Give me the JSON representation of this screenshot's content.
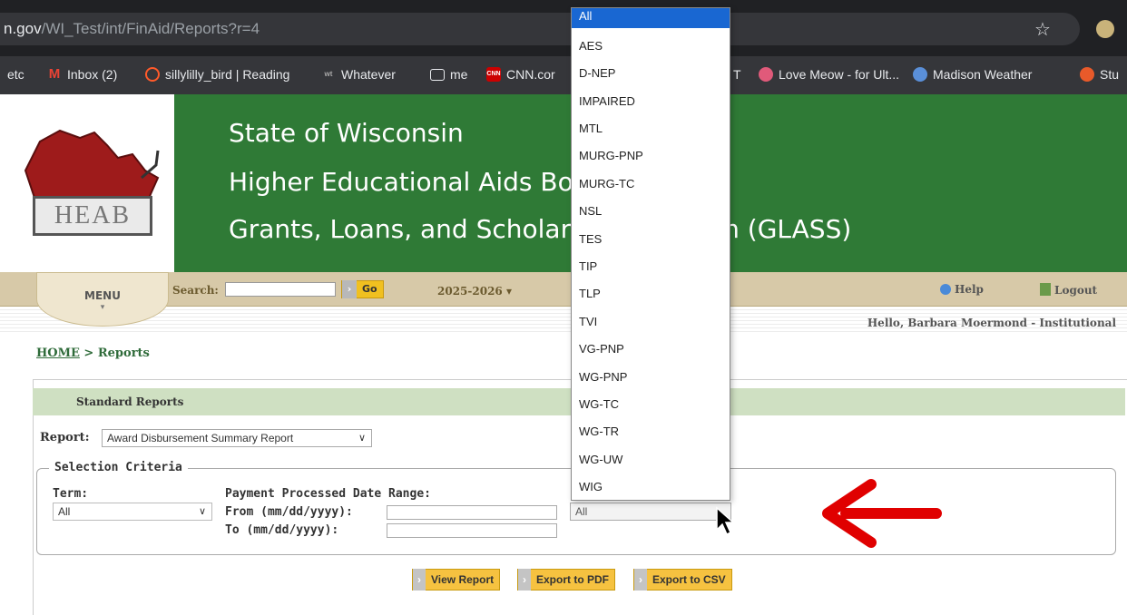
{
  "browser": {
    "url_domain": "n.gov",
    "url_path": "/WI_Test/int/FinAid/Reports?r=4",
    "bookmarks": [
      {
        "label": "etc",
        "icon": "none"
      },
      {
        "label": "Inbox (2)",
        "icon": "gmail-icon"
      },
      {
        "label": "sillylilly_bird | Reading",
        "icon": "spiral-icon"
      },
      {
        "label": "Whatever",
        "icon": "whatever-icon"
      },
      {
        "label": "me",
        "icon": "folder-icon"
      },
      {
        "label": "CNN.cor",
        "icon": "cnn-icon"
      },
      {
        "label": "T",
        "icon": "none"
      },
      {
        "label": "Love Meow - for Ult...",
        "icon": "heart-icon"
      },
      {
        "label": "Madison Weather",
        "icon": "weather-icon"
      },
      {
        "label": "Stu",
        "icon": "app-icon"
      }
    ]
  },
  "header": {
    "logo_text": "HEAB",
    "line1": "State of Wisconsin",
    "line2": "Higher Educational Aids Board (HEAB)",
    "line3": "Grants, Loans, and Scholarships System (GLASS)"
  },
  "nav": {
    "menu_label": "MENU",
    "search_label": "Search:",
    "go_label": "Go",
    "year_label": "2025-2026 ▾",
    "help_label": "Help",
    "logout_label": "Logout",
    "hello": "Hello, Barbara Moermond - Institutional"
  },
  "breadcrumb": {
    "home": "HOME",
    "separator": " > ",
    "current": "Reports"
  },
  "panel": {
    "title": "Standard Reports",
    "report_label": "Report:",
    "report_value": "Award Disbursement Summary Report",
    "criteria_legend": "Selection Criteria",
    "term_label": "Term:",
    "term_value": "All",
    "date_range_label": "Payment Processed Date Range:",
    "from_label": "From (mm/dd/yyyy):",
    "to_label": "To (mm/dd/yyyy):",
    "program_value": "All"
  },
  "buttons": {
    "view": "View Report",
    "pdf": "Export to PDF",
    "csv": "Export to CSV"
  },
  "dropdown": {
    "options": [
      "All",
      "AES",
      "D-NEP",
      "IMPAIRED",
      "MTL",
      "MURG-PNP",
      "MURG-TC",
      "NSL",
      "TES",
      "TIP",
      "TLP",
      "TVI",
      "VG-PNP",
      "WG-PNP",
      "WG-TC",
      "WG-TR",
      "WG-UW",
      "WIG"
    ],
    "selected": "All"
  },
  "colors": {
    "header_green": "#2f7a36",
    "arrow_red": "#e00000",
    "button_yellow": "#f6c240"
  }
}
